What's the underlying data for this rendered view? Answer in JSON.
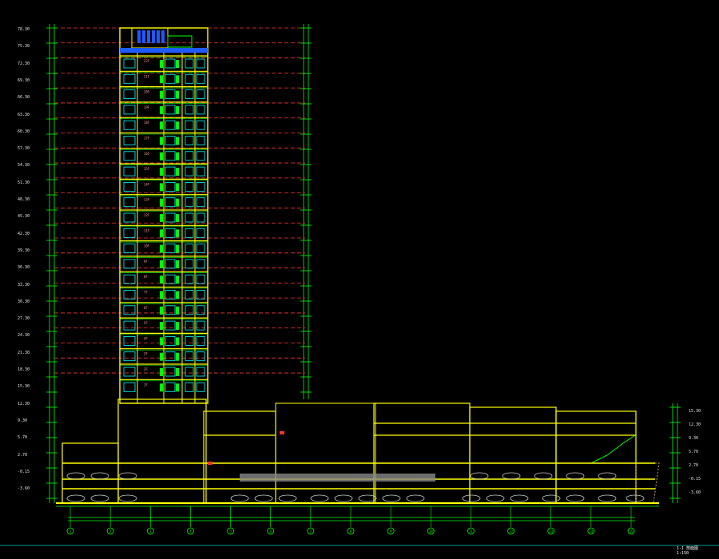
{
  "drawing": {
    "title": "1-1 剖面图",
    "scale": "1:150",
    "background": "#000000",
    "colors": {
      "structure": "#ffff00",
      "window": "#00ffff",
      "slab": "#00ff00",
      "axis": "#ff3333",
      "dim": "#e8e8e8",
      "accent": "#1e5bff",
      "hatch": "#888888",
      "grid_bubble": "#00ff00"
    }
  },
  "tower": {
    "floor_count": 22,
    "floor_tags": [
      "22F",
      "21F",
      "20F",
      "19F",
      "18F",
      "17F",
      "16F",
      "15F",
      "14F",
      "13F",
      "12F",
      "11F",
      "10F",
      "9F",
      "8F",
      "7F",
      "6F",
      "5F",
      "4F",
      "3F",
      "2F",
      "1F"
    ]
  },
  "podium": {
    "parking_level_tag": "B1"
  },
  "axis_bubbles": [
    "1",
    "2",
    "3",
    "4",
    "5",
    "6",
    "7",
    "8",
    "9",
    "10",
    "11",
    "12",
    "13",
    "14",
    "15"
  ],
  "left_elevations": [
    "78.30",
    "75.30",
    "72.30",
    "69.30",
    "66.30",
    "63.30",
    "60.30",
    "57.30",
    "54.30",
    "51.30",
    "48.30",
    "45.30",
    "42.30",
    "39.30",
    "36.30",
    "33.30",
    "30.30",
    "27.30",
    "24.30",
    "21.30",
    "18.30",
    "15.30",
    "12.30",
    "9.30",
    "5.70",
    "2.70",
    "-0.15",
    "-3.60"
  ],
  "right_elevations": [
    "15.30",
    "12.30",
    "9.30",
    "5.70",
    "2.70",
    "-0.15",
    "-3.60"
  ]
}
